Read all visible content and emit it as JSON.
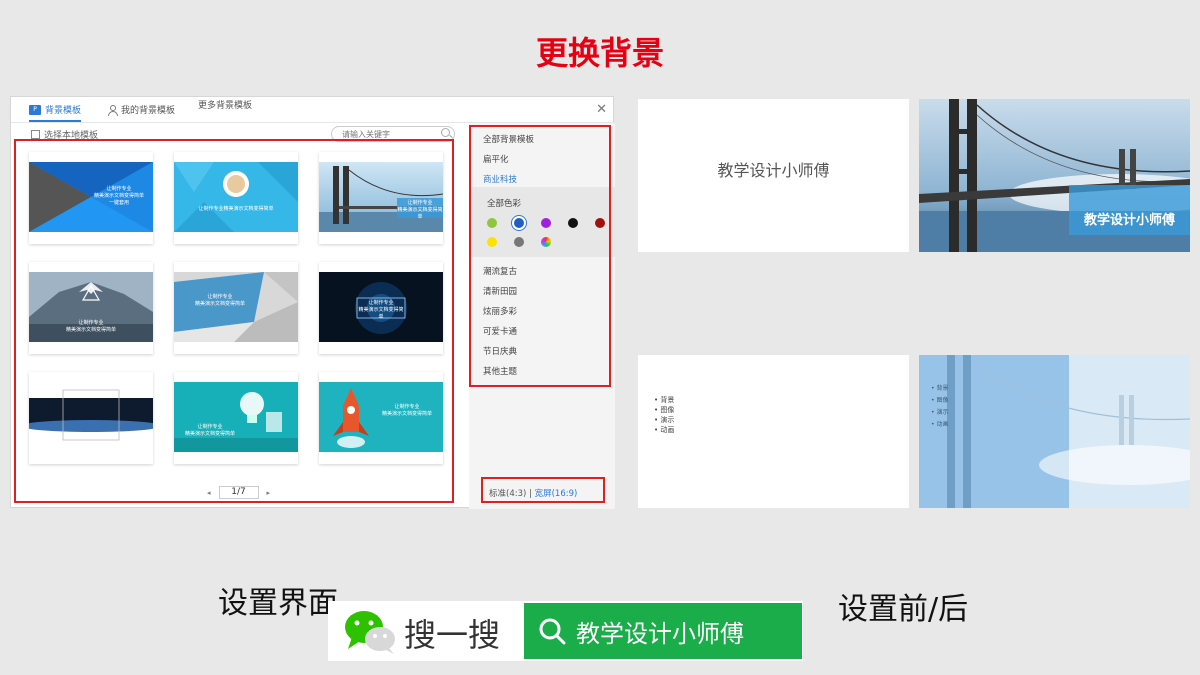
{
  "slide_title": "更换背景",
  "dialog": {
    "tabs": [
      {
        "label": "背景模板",
        "icon_text": "P"
      },
      {
        "label": "我的背景模板"
      },
      {
        "label": "更多背景模板"
      }
    ],
    "use_local_label": "选择本地模板",
    "search_placeholder": "请输入关键字",
    "cards": [
      {
        "lines": [
          "让制作专业",
          "精美演示文档变得简单",
          "一键套用"
        ]
      },
      {
        "lines": [
          "让制作专业精美演示文档变得简单"
        ]
      },
      {
        "lines": [
          "让制作专业",
          "精美演示文档变得简单"
        ]
      },
      {
        "lines": [
          "让制作专业",
          "精美演示文档变得简单"
        ]
      },
      {
        "lines": [
          "让制作专业",
          "精美演示文档变得简单"
        ]
      },
      {
        "lines": [
          "让制作专业",
          "精美演示文档变得简单"
        ]
      },
      {
        "lines": []
      },
      {
        "lines": [
          "让制作专业",
          "精美演示文档变得简单"
        ]
      },
      {
        "lines": [
          "让制作专业",
          "精美演示文档变得简单"
        ]
      }
    ],
    "pager": {
      "prev": "◂",
      "page": "1/7",
      "next": "▸"
    },
    "categories_top": [
      "全部背景模板",
      "扁平化",
      "商业科技"
    ],
    "color_label": "全部色彩",
    "swatches": [
      "#8ec63f",
      "#1f5fbf",
      "#a020e0",
      "#111111",
      "#a01010",
      "#ffe000",
      "#777777",
      "rainbow"
    ],
    "categories_bottom": [
      "潮流复古",
      "清新田园",
      "炫丽多彩",
      "可爱卡通",
      "节日庆典",
      "其他主题"
    ],
    "ratio_standard": "标准(4:3)",
    "ratio_sep": "|",
    "ratio_wide": "宽屏(16:9)"
  },
  "preview": {
    "before_title": "教学设计小师傅",
    "after_title": "教学设计小师傅",
    "bullets": [
      "背景",
      "图像",
      "演示",
      "动画"
    ]
  },
  "captions": {
    "left": "设置界面",
    "right": "设置前/后"
  },
  "wechat": {
    "search_label": "搜一搜",
    "query": "教学设计小师傅"
  }
}
